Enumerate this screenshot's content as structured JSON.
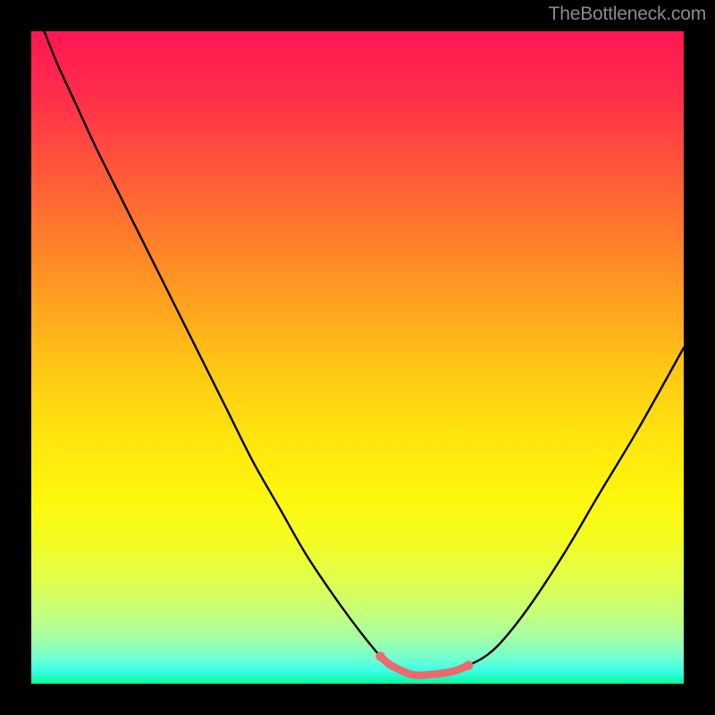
{
  "watermark": "TheBottleneck.com",
  "chart_data": {
    "type": "line",
    "title": "",
    "xlabel": "",
    "ylabel": "",
    "xlim": [
      0,
      100
    ],
    "ylim": [
      0,
      100
    ],
    "series": [
      {
        "name": "black-curve",
        "color": "#000000",
        "x": [
          2,
          4,
          7,
          10,
          14,
          18,
          22,
          26,
          30,
          34,
          38,
          42,
          46,
          50,
          53.5,
          55,
          57,
          58,
          59,
          60,
          61,
          63,
          65,
          67,
          70,
          73,
          77,
          82,
          87,
          93,
          100
        ],
        "values": [
          100,
          95,
          88.5,
          82,
          74,
          66,
          58,
          50,
          42,
          34,
          27,
          20,
          14,
          8.5,
          4.2,
          2.9,
          1.9,
          1.5,
          1.3,
          1.3,
          1.4,
          1.6,
          2.0,
          2.8,
          4.5,
          7.5,
          12.8,
          20.5,
          29,
          39,
          51.5
        ]
      },
      {
        "name": "red-trough",
        "color": "#ec6a6a",
        "x": [
          53.5,
          55,
          57,
          58,
          59,
          60,
          61,
          63,
          65,
          67
        ],
        "values": [
          4.2,
          2.9,
          1.9,
          1.5,
          1.3,
          1.3,
          1.4,
          1.6,
          2.0,
          2.8
        ]
      }
    ],
    "grid": false,
    "legend": false
  }
}
